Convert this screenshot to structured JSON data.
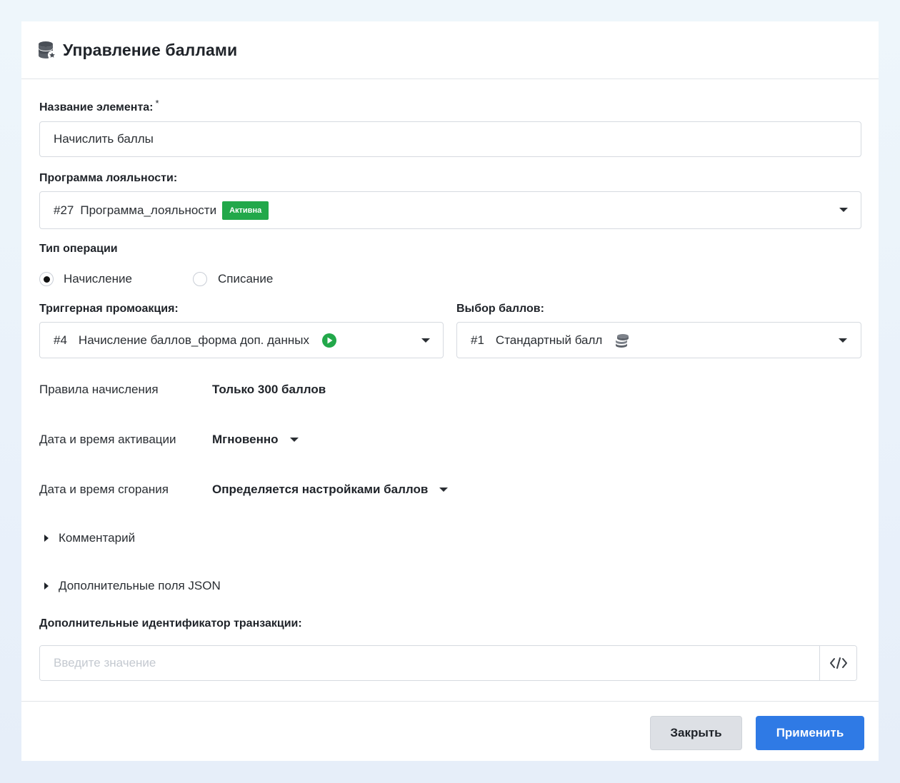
{
  "header": {
    "title": "Управление баллами",
    "icon": "coins-gear-icon"
  },
  "element_name": {
    "label": "Название элемента:",
    "required_mark": "*",
    "value": "Начислить баллы"
  },
  "loyalty_program": {
    "label": "Программа лояльности:",
    "number": "#27",
    "name": "Программа_лояльности",
    "status_badge": "Активна",
    "badge_color": "#22a84a"
  },
  "operation_type": {
    "label": "Тип операции",
    "options": [
      {
        "label": "Начисление",
        "checked": true
      },
      {
        "label": "Списание",
        "checked": false
      }
    ]
  },
  "trigger_promo": {
    "label": "Триггерная промоакция:",
    "number": "#4",
    "name": "Начисление баллов_форма доп. данных",
    "status_icon": "play-circle-icon",
    "status_color": "#22a84a"
  },
  "points_choice": {
    "label": "Выбор баллов:",
    "number": "#1",
    "name": "Стандартный балл",
    "icon": "coins-icon"
  },
  "rules": {
    "label": "Правила начисления",
    "value": "Только 300 баллов"
  },
  "activation": {
    "label": "Дата и время активации",
    "value": "Мгновенно"
  },
  "expiration": {
    "label": "Дата и время сгорания",
    "value": "Определяется настройками баллов"
  },
  "comment": {
    "label": "Комментарий"
  },
  "json_fields": {
    "label": "Дополнительные поля JSON"
  },
  "transaction_id": {
    "label": "Дополнительные идентификатор транзакции:",
    "placeholder": "Введите значение"
  },
  "footer": {
    "close_label": "Закрыть",
    "apply_label": "Применить",
    "primary_color": "#2f7ae5"
  }
}
